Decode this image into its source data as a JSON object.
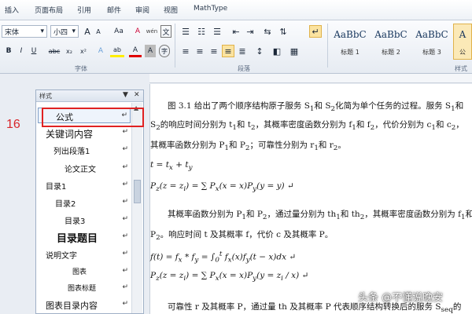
{
  "menu": {
    "tabs": [
      "插入",
      "页面布局",
      "引用",
      "邮件",
      "审阅",
      "视图",
      "MathType"
    ]
  },
  "ribbon": {
    "font_name": "宋体",
    "font_size": "小四",
    "grow_font": "A",
    "shrink_font": "A",
    "change_case": "Aa",
    "clear_format": "A",
    "wen": "wén",
    "wen_char": "文",
    "bold": "B",
    "italic": "I",
    "underline": "U",
    "strike": "abc",
    "subscript": "x₂",
    "superscript": "x²",
    "text_effect": "A",
    "highlight": "ab",
    "font_color": "A",
    "char_shade": "A",
    "enclose": "字",
    "font_group_label": "字体",
    "paragraph_group_label": "段落",
    "styles_group_label": "样式",
    "styles": [
      {
        "sample": "AaBbC",
        "name": "标题 1"
      },
      {
        "sample": "AaBbC",
        "name": "标题 2"
      },
      {
        "sample": "AaBbC",
        "name": "标题 3"
      },
      {
        "sample": "A",
        "name": "公"
      }
    ]
  },
  "styles_pane": {
    "title": "样式",
    "items": [
      {
        "label": "公式",
        "mark": "↵"
      },
      {
        "label": "关键词内容",
        "mark": "↵"
      },
      {
        "label": "列出段落1",
        "mark": "↵"
      },
      {
        "label": "论文正文",
        "mark": "↵"
      },
      {
        "label": "目录1",
        "mark": "↵"
      },
      {
        "label": "目录2",
        "mark": "↵"
      },
      {
        "label": "目录3",
        "mark": "↵"
      },
      {
        "label": "目录题目",
        "mark": "↵"
      },
      {
        "label": "说明文字",
        "mark": "↵"
      },
      {
        "label": "图表",
        "mark": "↵"
      },
      {
        "label": "图表标题",
        "mark": "↵"
      },
      {
        "label": "图表目录内容",
        "mark": "↵"
      }
    ]
  },
  "annotation": {
    "number": "16"
  },
  "document": {
    "p1a": "图 3.1 给出了两个顺序结构原子服务 S",
    "p1b": "和 S",
    "p1c": "化简为单个任务的过程。服务 S",
    "p1d": "和",
    "p2a": "S",
    "p2b": "的响应时间分别为 t",
    "p2c": "和 t",
    "p2d": "，其概率密度函数分别为 f",
    "p2e": "和 f",
    "p2f": "，代价分别为 c",
    "p2g": "和 c",
    "p2h": "，",
    "p3a": "其概率函数分别为 P",
    "p3b": "和 P",
    "p3c": "；可靠性分别为 r",
    "p3d": "和 r",
    "p3e": "。",
    "eq1": "t = t",
    "eq1b": " + t",
    "eq2": "P",
    "eq2b": "(z = z",
    "eq2c": ") = ∑ P",
    "eq2d": "(x = x)P",
    "eq2e": "(y = y) ↵",
    "p4a": "其概率函数分别为 P",
    "p4b": "和 P",
    "p4c": "，通过量分别为 th",
    "p4d": "和 th",
    "p4e": "，其概率密度函数分别为 f",
    "p4f": "和",
    "p5a": "P",
    "p5b": "。响应时间 t 及其概率 f，代价 c 及其概率 P。",
    "eq3": "f(t) = f",
    "eq3b": " * f",
    "eq3c": " = ∫",
    "eq3d": " f",
    "eq3e": "(x)f",
    "eq3f": "(t − x)dx ↵",
    "eq4": "P",
    "eq4b": "(z = z",
    "eq4c": ") = ∑ P",
    "eq4d": "(x = x)P",
    "eq4e": "(y = z",
    "eq4f": " / x) ↵",
    "p6a": "可靠性 r 及其概率 P，通过量 th 及其概率 P 代表顺序结构转换后的服务 S",
    "p6b": "的",
    "sub_1": "1",
    "sub_2": "2",
    "sub_x": "x",
    "sub_y": "y",
    "sub_z": "z",
    "sub_i": "i",
    "sub_t": "t",
    "sub_0": "0",
    "sub_sum": "z=x+y",
    "sub_sum2": "x·y=z",
    "sub_seq": "seq"
  },
  "watermark": "头条 @不懂说晚安"
}
